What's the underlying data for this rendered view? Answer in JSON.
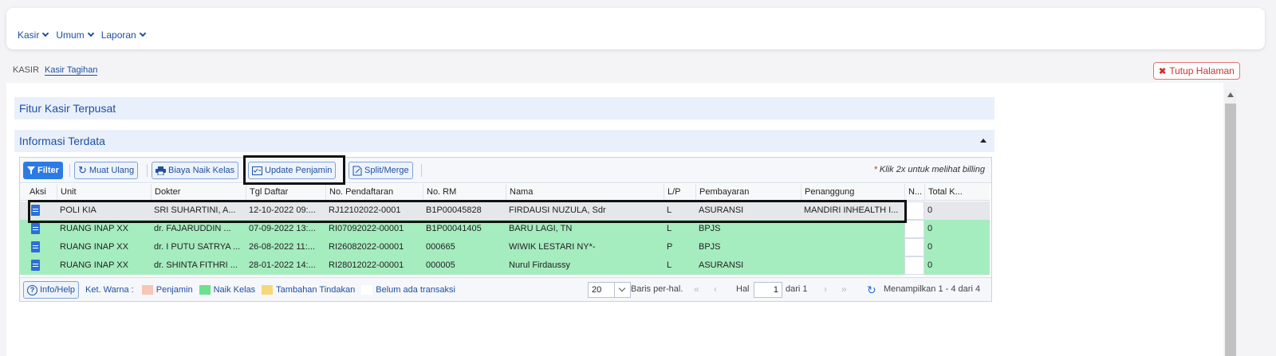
{
  "nav": {
    "menu": [
      "Kasir",
      "Umum",
      "Laporan"
    ]
  },
  "breadcrumb": {
    "root": "KASIR",
    "current": "Kasir Tagihan"
  },
  "close_button": "Tutup Halaman",
  "panels": {
    "fitur": "Fitur Kasir Terpusat",
    "informasi": "Informasi Terdata"
  },
  "toolbar": {
    "filter": "Filter",
    "reload": "Muat Ulang",
    "biaya_naik_kelas": "Biaya Naik Kelas",
    "update_penjamin": "Update Penjamin",
    "split_merge": "Split/Merge",
    "note_star": "*",
    "note": "Klik 2x untuk melihat billing"
  },
  "columns": [
    "Aksi",
    "Unit",
    "Dokter",
    "Tgl Daftar",
    "No. Pendaftaran",
    "No. RM",
    "Nama",
    "L/P",
    "Pembayaran",
    "Penanggung",
    "N...",
    "Total K..."
  ],
  "rows": [
    {
      "unit": "POLI KIA",
      "dokter": "SRI SUHARTINI, A...",
      "tgl": "12-10-2022 09:...",
      "no_pendaftaran": "RJ12102022-0001",
      "no_rm": "B1P00045828",
      "nama": "FIRDAUSI NUZULA, Sdr",
      "lp": "L",
      "pembayaran": "ASURANSI",
      "penanggung": "MANDIRI INHEALTH I...",
      "n": "",
      "total": "0",
      "status": "none"
    },
    {
      "unit": "RUANG INAP XX",
      "dokter": "dr. FAJARUDDIN ...",
      "tgl": "07-09-2022 13:...",
      "no_pendaftaran": "RI07092022-00001",
      "no_rm": "B1P00041405",
      "nama": "BARU LAGI, TN",
      "lp": "L",
      "pembayaran": "BPJS",
      "penanggung": "",
      "n": "",
      "total": "0",
      "status": "naik-kelas"
    },
    {
      "unit": "RUANG INAP XX",
      "dokter": "dr. I PUTU SATRYA ...",
      "tgl": "26-08-2022 11:...",
      "no_pendaftaran": "RI26082022-00001",
      "no_rm": "000665",
      "nama": "WIWIK LESTARI NY*-",
      "lp": "P",
      "pembayaran": "BPJS",
      "penanggung": "",
      "n": "",
      "total": "0",
      "status": "naik-kelas"
    },
    {
      "unit": "RUANG INAP XX",
      "dokter": "dr. SHINTA FITHRI ...",
      "tgl": "28-01-2022 14:...",
      "no_pendaftaran": "RI28012022-00001",
      "no_rm": "000005",
      "nama": "Nurul Firdaussy",
      "lp": "L",
      "pembayaran": "ASURANSI",
      "penanggung": "",
      "n": "",
      "total": "0",
      "status": "naik-kelas"
    }
  ],
  "footer": {
    "info_help": "Info/Help",
    "legend_label": "Ket. Warna :",
    "legend": [
      {
        "label": "Penjamin",
        "color": "#f7c6b8"
      },
      {
        "label": "Naik Kelas",
        "color": "#6ee08f"
      },
      {
        "label": "Tambahan Tindakan",
        "color": "#f6d77a"
      },
      {
        "label": "Belum ada transaksi",
        "color": "#ffffff"
      }
    ],
    "page_size": "20",
    "per_page": "Baris per-hal.",
    "hal": "Hal",
    "page": "1",
    "of": "dari 1",
    "showing": "Menampilkan 1 - 4 dari 4"
  },
  "colors": {
    "accent": "#2c7be5",
    "link": "#1e50a0",
    "row_green": "#a5ecbf",
    "danger": "#d32f2f"
  }
}
